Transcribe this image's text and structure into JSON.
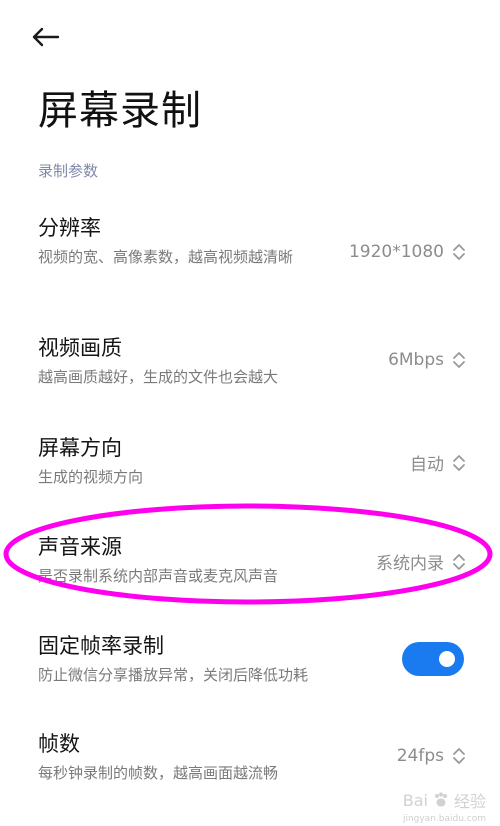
{
  "header": {
    "title": "屏幕录制"
  },
  "section": {
    "label": "录制参数"
  },
  "settings": {
    "resolution": {
      "title": "分辨率",
      "desc": "视频的宽、高像素数，越高视频越清晰",
      "value": "1920*1080"
    },
    "quality": {
      "title": "视频画质",
      "desc": "越高画质越好，生成的文件也会越大",
      "value": "6Mbps"
    },
    "orientation": {
      "title": "屏幕方向",
      "desc": "生成的视频方向",
      "value": "自动"
    },
    "audio_source": {
      "title": "声音来源",
      "desc": "是否录制系统内部声音或麦克风声音",
      "value": "系统内录"
    },
    "fixed_fps": {
      "title": "固定帧率录制",
      "desc": "防止微信分享播放异常，关闭后降低功耗",
      "enabled": true
    },
    "fps": {
      "title": "帧数",
      "desc": "每秒钟录制的帧数，越高画面越流畅",
      "value": "24fps"
    }
  },
  "watermark": {
    "brand": "Bai",
    "brand2": "经验",
    "sub": "jingyan.baidu.com"
  },
  "colors": {
    "accent": "#1a7bf0",
    "annotation": "#ff00ee",
    "section_header": "#8088a8"
  },
  "icons": {
    "back": "arrow-left-icon",
    "value_picker": "chevron-up-down-icon"
  }
}
